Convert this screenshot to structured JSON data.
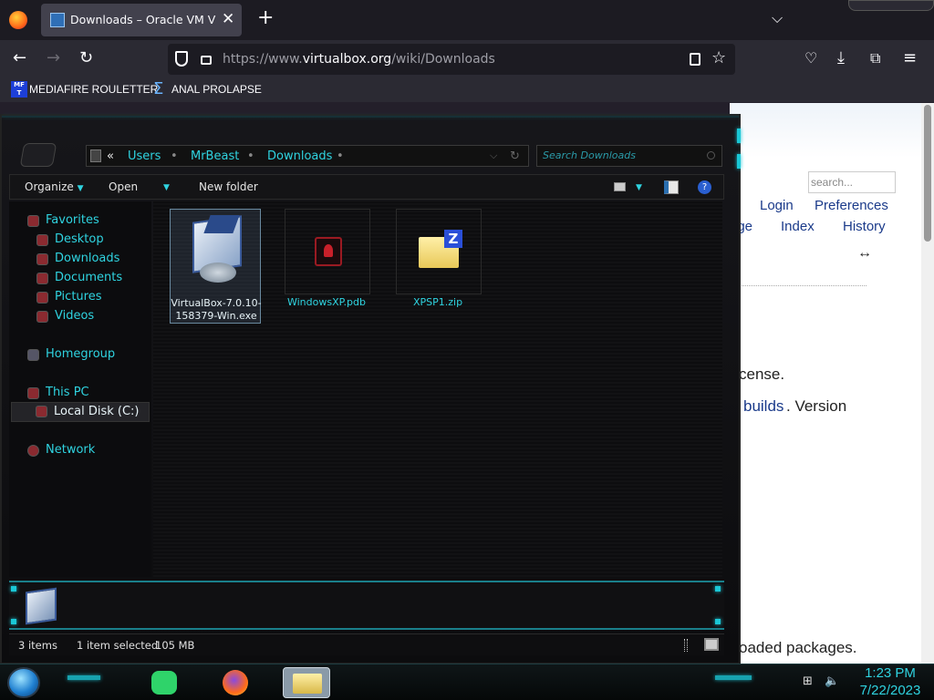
{
  "browser": {
    "tab_title": "Downloads – Oracle VM VirtualBox",
    "tab_close": "✕",
    "new_tab": "+",
    "tab_list": "⌵",
    "url_prefix": "https://www.",
    "url_domain": "virtualbox.org",
    "url_path": "/wiki/Downloads",
    "bookmarks": [
      {
        "label": "MEDIAFIRE ROULETTER",
        "icon": "mediafire-icon"
      },
      {
        "label": "ANAL PROLAPSE",
        "icon": "bookmark-icon"
      }
    ]
  },
  "webpage": {
    "search_placeholder": "search...",
    "links": {
      "login": "Login",
      "preferences": "Preferences",
      "page_partial": "age",
      "index": "Index",
      "history": "History",
      "builds": "builds"
    },
    "text": {
      "license": "cense.",
      "version": ". Version",
      "packages": "oaded packages.",
      "resize_cursor": "↔"
    }
  },
  "explorer": {
    "breadcrumb": {
      "overflow": "«",
      "items": [
        "Users",
        "MrBeast",
        "Downloads"
      ]
    },
    "search_placeholder": "Search Downloads",
    "commands": {
      "organize": "Organize",
      "open": "Open",
      "new_folder": "New folder"
    },
    "nav": {
      "favorites": "Favorites",
      "favorites_items": [
        "Desktop",
        "Downloads",
        "Documents",
        "Pictures",
        "Videos"
      ],
      "homegroup": "Homegroup",
      "this_pc": "This PC",
      "local_disk": "Local Disk (C:)",
      "network": "Network"
    },
    "files": [
      {
        "name": "VirtualBox-7.0.10-158379-Win.exe",
        "icon": "virtualbox-installer-icon",
        "selected": true
      },
      {
        "name": "WindowsXP.pdb",
        "icon": "pdb-file-icon",
        "selected": false
      },
      {
        "name": "XPSP1.zip",
        "icon": "zip-folder-icon",
        "selected": false
      }
    ],
    "status": {
      "item_count": "3 items",
      "selection": "1 item selected",
      "size": "105 MB"
    }
  },
  "taskbar": {
    "time": "1:23 PM",
    "date": "7/22/2023"
  },
  "colors": {
    "accent_cyan": "#2fd3e0",
    "firefox_bg": "#2b2a33",
    "link_blue": "#1a3a8a"
  }
}
